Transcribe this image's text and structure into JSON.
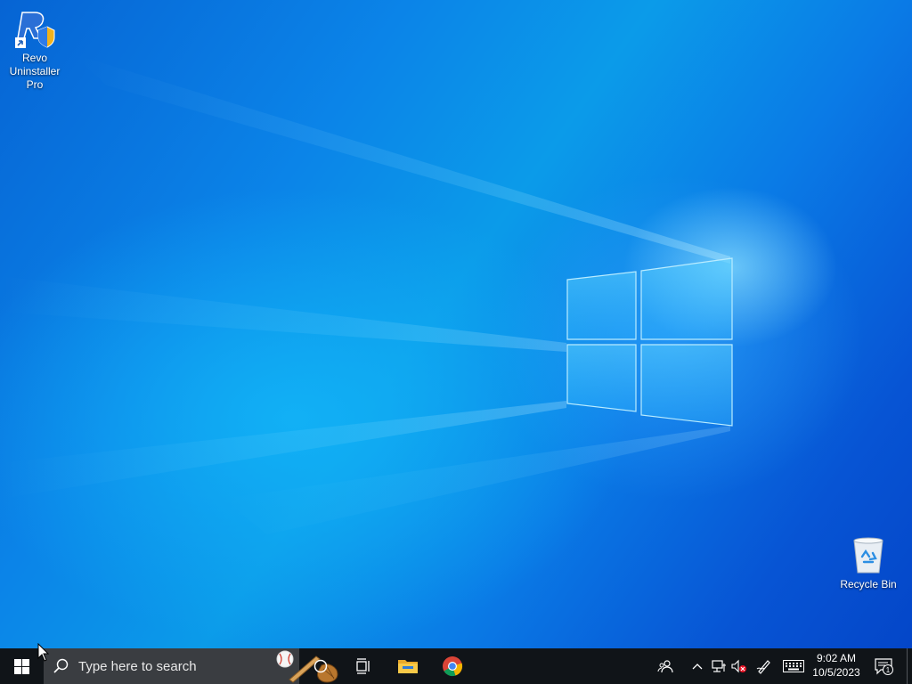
{
  "desktop": {
    "icons": [
      {
        "label": "Revo\nUninstaller\nPro",
        "icon": "revo-uninstaller-icon"
      },
      {
        "label": "Recycle Bin",
        "icon": "recycle-bin-icon"
      }
    ]
  },
  "taskbar": {
    "start_icon": "windows-logo-icon",
    "search": {
      "placeholder": "Type here to search",
      "icon": "search-icon"
    },
    "pinned": [
      {
        "name": "Cortana",
        "icon": "cortana-circle-icon"
      },
      {
        "name": "Task View",
        "icon": "task-view-icon"
      },
      {
        "name": "File Explorer",
        "icon": "folder-icon"
      },
      {
        "name": "Google Chrome",
        "icon": "chrome-icon"
      }
    ],
    "tray": {
      "icons": [
        "people-icon",
        "chevron-up-icon",
        "network-icon",
        "volume-muted-icon",
        "pen-icon",
        "keyboard-icon"
      ],
      "time": "9:02 AM",
      "date": "10/5/2023",
      "notification_count": "1"
    }
  }
}
